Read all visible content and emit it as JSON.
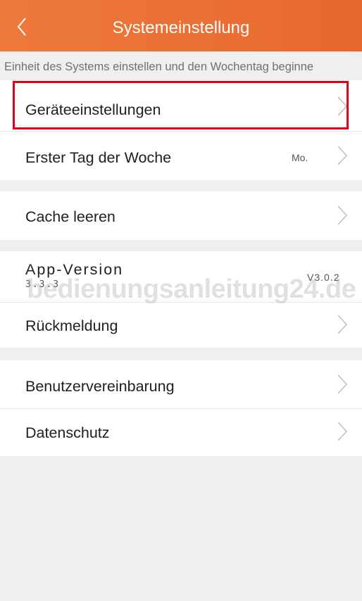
{
  "header": {
    "title": "Systemeinstellung",
    "back_icon": "chevron-left-icon",
    "colors": {
      "start": "#ee7a3c",
      "end": "#e8672d"
    }
  },
  "subtitle": "Einheit des Systems einstellen und den Wochentag beginne",
  "rows": {
    "device_settings": {
      "label": "Geräteeinstellungen"
    },
    "first_day": {
      "label": "Erster Tag der Woche",
      "value": "Mo."
    },
    "clear_cache": {
      "label": "Cache leeren"
    },
    "app_version": {
      "label": "App-Version",
      "sub_value": "3.3.3",
      "value": "V3.0.2"
    },
    "feedback": {
      "label": "Rückmeldung"
    },
    "user_agreement": {
      "label": "Benutzervereinbarung"
    },
    "privacy": {
      "label": "Datenschutz"
    }
  },
  "watermark": "bedienungsanleitung24.de",
  "highlight_color": "#e0001b"
}
